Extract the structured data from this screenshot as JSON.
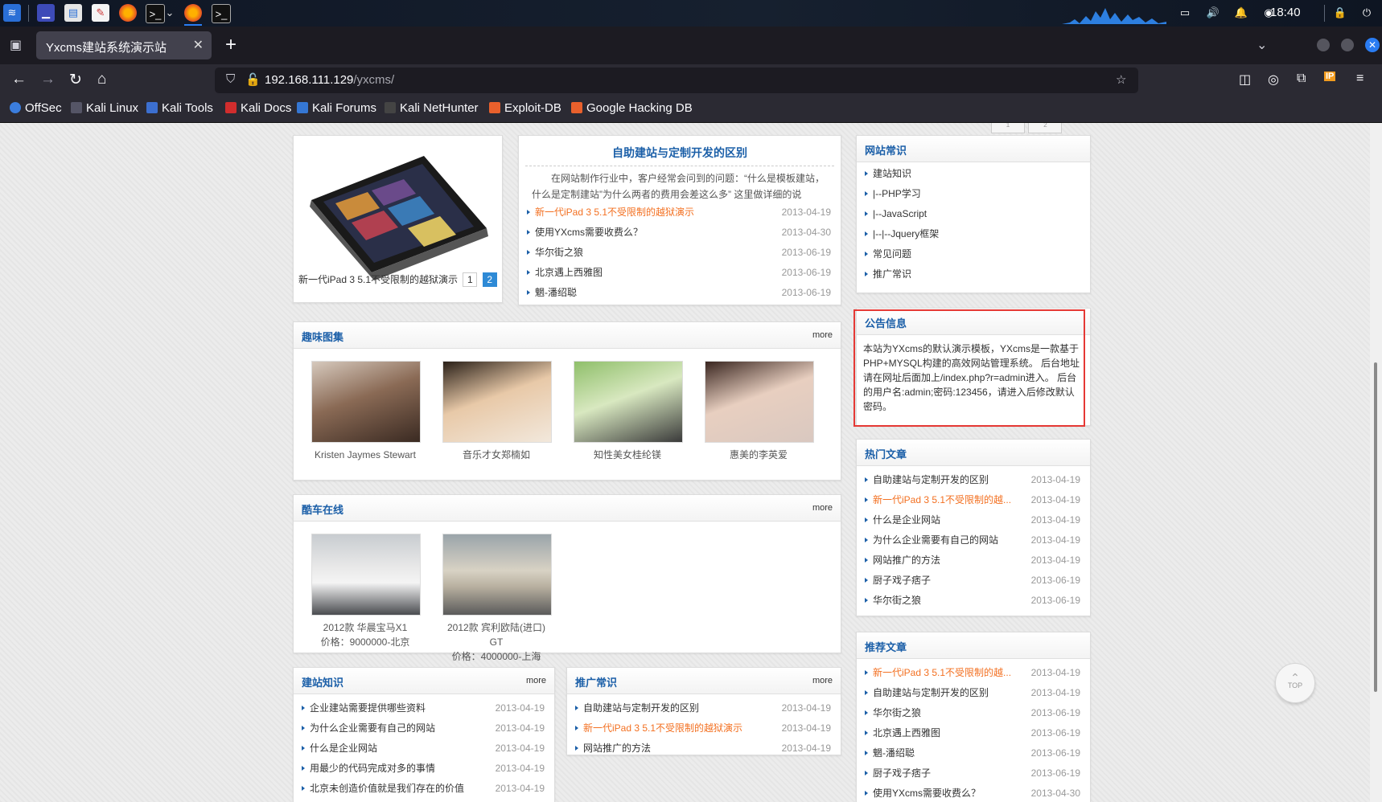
{
  "os": {
    "clock": "18:40"
  },
  "browser": {
    "tab_title": "Yxcms建站系统演示站",
    "url_host": "192.168.111.129",
    "url_path": "/yxcms/",
    "bookmarks": [
      "OffSec",
      "Kali Linux",
      "Kali Tools",
      "Kali Docs",
      "Kali Forums",
      "Kali NetHunter",
      "Exploit-DB",
      "Google Hacking DB"
    ]
  },
  "top_pager": [
    "1",
    "2"
  ],
  "slideshow": {
    "caption": "新一代iPad 3 5.1不受限制的越狱演示",
    "pages": [
      "1",
      "2"
    ]
  },
  "headline": {
    "title": "自助建站与定制开发的区别",
    "summary": "在网站制作行业中，客户经常会问到的问题：“什么是模板建站，什么是定制建站”为什么两者的费用会差这么多” 这里做详细的说",
    "items": [
      {
        "title": "新一代iPad 3 5.1不受限制的越狱演示",
        "date": "2013-04-19",
        "hot": true
      },
      {
        "title": "使用YXcms需要收费么？",
        "date": "2013-04-30",
        "hot": false
      },
      {
        "title": "华尔街之狼",
        "date": "2013-06-19",
        "hot": false
      },
      {
        "title": "北京遇上西雅图",
        "date": "2013-06-19",
        "hot": false
      },
      {
        "title": "魍-潘绍聪",
        "date": "2013-06-19",
        "hot": false
      }
    ]
  },
  "gallery": {
    "title": "趣味图集",
    "more": "more",
    "items": [
      "Kristen Jaymes Stewart",
      "音乐才女郑楠如",
      "知性美女桂纶镁",
      "惠美的李英爱"
    ]
  },
  "cars": {
    "title": "酷车在线",
    "more": "more",
    "items": [
      {
        "name": "2012款 华晨宝马X1",
        "price": "价格：9000000-北京"
      },
      {
        "name": "2012款 宾利欧陆(进口) GT",
        "price": "价格：4000000-上海"
      }
    ]
  },
  "knowledge": {
    "title": "建站知识",
    "more": "more",
    "items": [
      {
        "title": "企业建站需要提供哪些资料",
        "date": "2013-04-19"
      },
      {
        "title": "为什么企业需要有自己的网站",
        "date": "2013-04-19"
      },
      {
        "title": "什么是企业网站",
        "date": "2013-04-19"
      },
      {
        "title": "用最少的代码完成对多的事情",
        "date": "2013-04-19"
      },
      {
        "title": "北京未创造价值就是我们存在的价值",
        "date": "2013-04-19"
      }
    ]
  },
  "promo": {
    "title": "推广常识",
    "more": "more",
    "items": [
      {
        "title": "自助建站与定制开发的区别",
        "date": "2013-04-19",
        "hot": false
      },
      {
        "title": "新一代iPad 3 5.1不受限制的越狱演示",
        "date": "2013-04-19",
        "hot": true
      },
      {
        "title": "网站推广的方法",
        "date": "2013-04-19",
        "hot": false
      }
    ]
  },
  "site_common": {
    "title": "网站常识",
    "items": [
      "建站知识",
      "|--PHP学习",
      "|--JavaScript",
      "|--|--Jquery框架",
      "常见问题",
      "推广常识"
    ]
  },
  "notice": {
    "title": "公告信息",
    "text": "本站为YXcms的默认演示模板，YXcms是一款基于PHP+MYSQL构建的高效网站管理系统。 后台地址请在网址后面加上/index.php?r=admin进入。 后台的用户名:admin;密码:123456，请进入后修改默认密码。"
  },
  "hot_articles": {
    "title": "热门文章",
    "items": [
      {
        "title": "自助建站与定制开发的区别",
        "date": "2013-04-19",
        "hot": false
      },
      {
        "title": "新一代iPad 3 5.1不受限制的越...",
        "date": "2013-04-19",
        "hot": true
      },
      {
        "title": "什么是企业网站",
        "date": "2013-04-19",
        "hot": false
      },
      {
        "title": "为什么企业需要有自己的网站",
        "date": "2013-04-19",
        "hot": false
      },
      {
        "title": "网站推广的方法",
        "date": "2013-04-19",
        "hot": false
      },
      {
        "title": "厨子戏子痞子",
        "date": "2013-06-19",
        "hot": false
      },
      {
        "title": "华尔街之狼",
        "date": "2013-06-19",
        "hot": false
      }
    ]
  },
  "recommended": {
    "title": "推荐文章",
    "items": [
      {
        "title": "新一代iPad 3 5.1不受限制的越...",
        "date": "2013-04-19",
        "hot": true
      },
      {
        "title": "自助建站与定制开发的区别",
        "date": "2013-04-19",
        "hot": false
      },
      {
        "title": "华尔街之狼",
        "date": "2013-06-19",
        "hot": false
      },
      {
        "title": "北京遇上西雅图",
        "date": "2013-06-19",
        "hot": false
      },
      {
        "title": "魍-潘绍聪",
        "date": "2013-06-19",
        "hot": false
      },
      {
        "title": "厨子戏子痞子",
        "date": "2013-06-19",
        "hot": false
      },
      {
        "title": "使用YXcms需要收费么？",
        "date": "2013-04-30",
        "hot": false
      }
    ]
  },
  "top_button": "TOP"
}
